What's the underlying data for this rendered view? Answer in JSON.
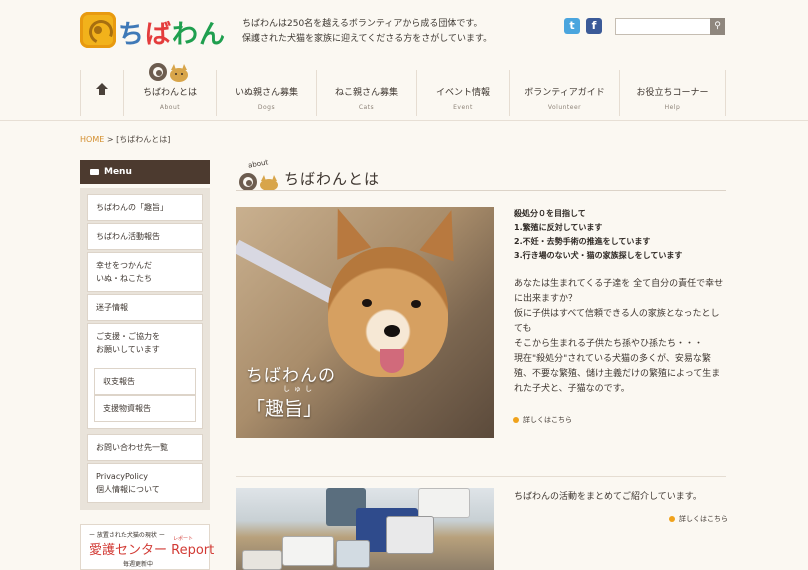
{
  "site": {
    "logo_text": "ちばわん",
    "intro_line1": "ちばわんは250名を越えるボランティアから成る団体です。",
    "intro_line2": "保護された犬猫を家族に迎えてくださる方をさがしています。",
    "social": [
      {
        "name": "twitter",
        "glyph": "t",
        "color": "#4aa5de"
      },
      {
        "name": "facebook",
        "glyph": "f",
        "color": "#3b5a98"
      }
    ],
    "search": {
      "placeholder": "",
      "button_icon": "search-icon"
    }
  },
  "nav": [
    {
      "jp": "",
      "en": "",
      "icon": "home-icon"
    },
    {
      "jp": "ちばわんとは",
      "en": "About"
    },
    {
      "jp": "いぬ親さん募集",
      "en": "Dogs"
    },
    {
      "jp": "ねこ親さん募集",
      "en": "Cats"
    },
    {
      "jp": "イベント情報",
      "en": "Event"
    },
    {
      "jp": "ボランティアガイド",
      "en": "Volunteer"
    },
    {
      "jp": "お役立ちコーナー",
      "en": "Help"
    }
  ],
  "breadcrumb": {
    "home": "HOME",
    "separator": ">",
    "current": "[ちばわんとは]"
  },
  "sidebar": {
    "header": "Menu",
    "items": [
      {
        "label": "ちばわんの「趣旨」"
      },
      {
        "label": "ちばわん活動報告"
      },
      {
        "label": "幸せをつかんだ\nいぬ・ねこたち"
      },
      {
        "label": "迷子情報"
      },
      {
        "label": "ご支援・ご協力を\nお願いしています"
      },
      {
        "label": "収支報告"
      },
      {
        "label": "支援物資報告"
      },
      {
        "label": "お問い合わせ先一覧"
      },
      {
        "label": "PrivacyPolicy\n個人情報について"
      }
    ],
    "banner": {
      "line1": "ー 放置された犬猫の現状 ー",
      "line2": "愛護センター Report",
      "ruby": "レポート",
      "line3": "毎週更新中"
    }
  },
  "main": {
    "about_tag": "about",
    "title": "ちばわんとは",
    "photo1": {
      "caption1": "ちばわんの",
      "ruby": "しゅし",
      "caption2": "「趣旨」"
    },
    "mission": [
      "殺処分０を目指して",
      "1.繁殖に反対しています",
      "2.不妊・去勢手術の推進をしています",
      "3.行き場のない犬・猫の家族探しをしています"
    ],
    "body1": "あなたは生まれてくる子達を 全て自分の責任で幸せに出来ますか？\n仮に子供はすべて信頼できる人の家族となったとしても\nそこから生まれる子供たち孫やひ孫たち・・・\n現在\"殺処分\"されている犬猫の多くが、安易な繁殖、不要な繁殖、儲け主義だけの繁殖によって生まれた子犬と、子猫なのです。",
    "more1": "詳しくはこちら",
    "body2": "ちばわんの活動をまとめてご紹介しています。",
    "more2": "詳しくはこちら"
  }
}
